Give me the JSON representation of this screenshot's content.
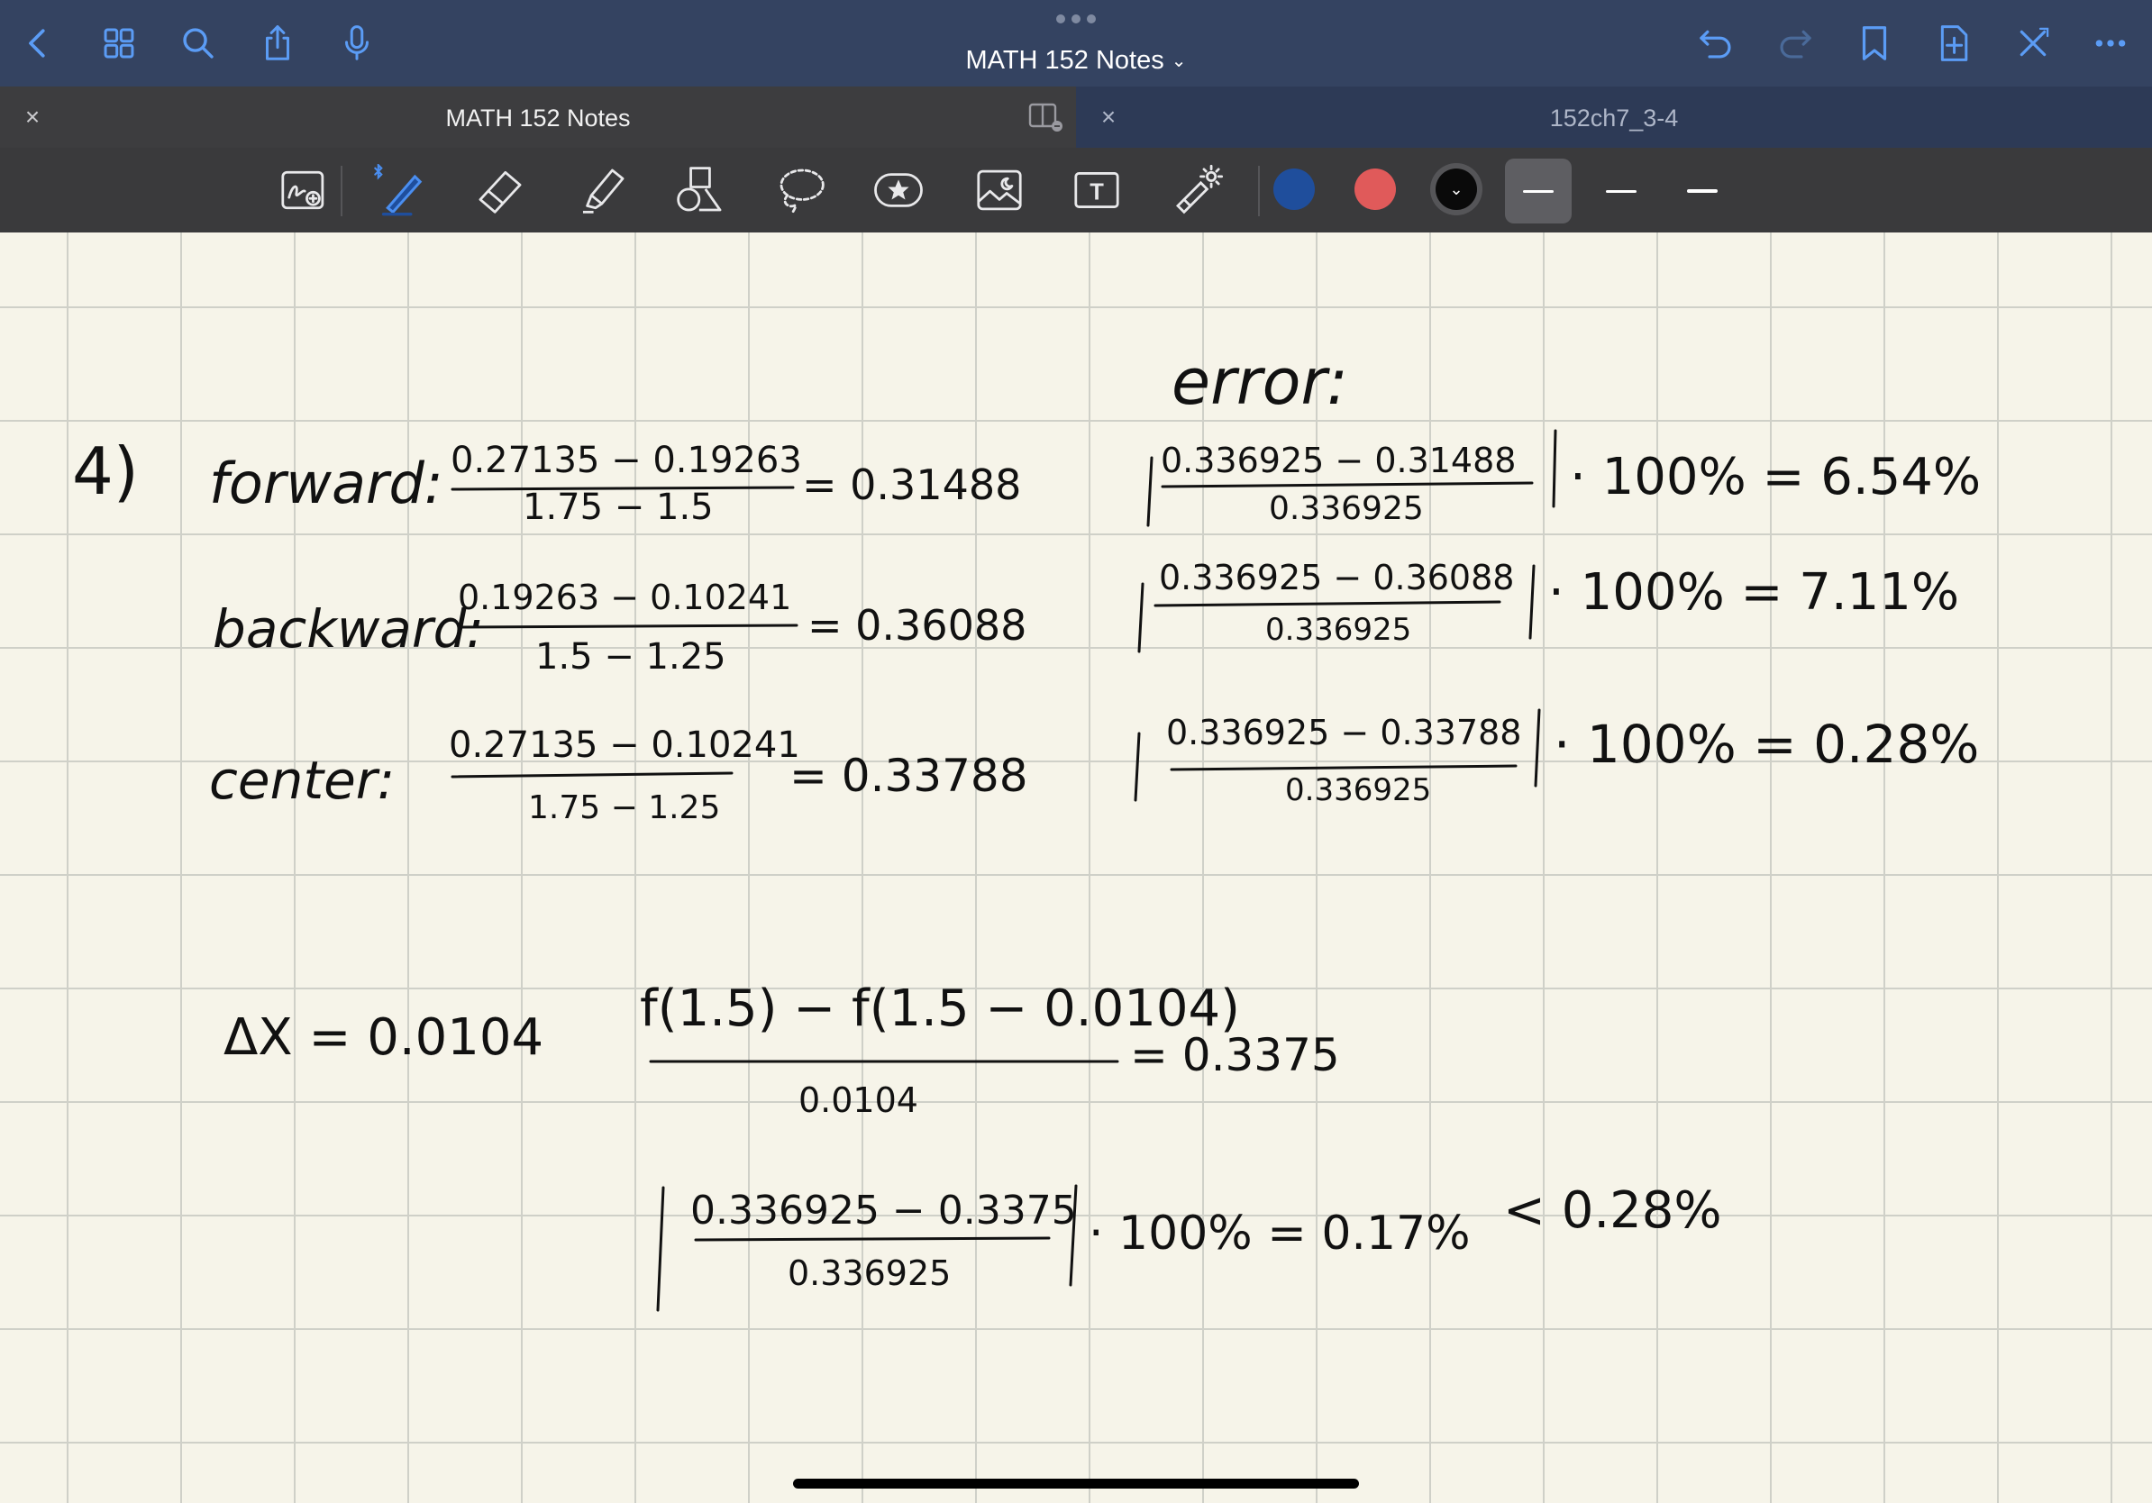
{
  "nav": {
    "title": "MATH 152 Notes",
    "left_icons": [
      "back-icon",
      "grid-icon",
      "search-icon",
      "share-icon",
      "microphone-icon"
    ],
    "right_icons": [
      "undo-icon",
      "redo-icon",
      "bookmark-icon",
      "add-page-icon",
      "close-x-icon",
      "more-icon"
    ]
  },
  "tabs": [
    {
      "label": "MATH 152 Notes",
      "active": true
    },
    {
      "label": "152ch7_3-4",
      "active": false
    }
  ],
  "toolbar": {
    "tools": [
      "zoom-window",
      "pen",
      "eraser",
      "highlighter",
      "shapes",
      "lasso",
      "sticker",
      "image",
      "text",
      "laser-pointer"
    ],
    "colors": [
      {
        "name": "blue",
        "hex": "#1f4e9c"
      },
      {
        "name": "red",
        "hex": "#e05a5a"
      },
      {
        "name": "black",
        "hex": "#0a0a0a",
        "selected": true
      }
    ],
    "stroke_widths": [
      "thin",
      "medium",
      "thick"
    ],
    "selected_stroke": "thin"
  },
  "notes": {
    "heading_error": "error:",
    "problem_number": "4)",
    "forward": {
      "label": "forward:",
      "numerator": "0.27135 − 0.19263",
      "denominator": "1.75 − 1.5",
      "result": "= 0.31488",
      "err_numerator": "0.336925 − 0.31488",
      "err_denominator": "0.336925",
      "err_result": "· 100% = 6.54%"
    },
    "backward": {
      "label": "backward:",
      "numerator": "0.19263 − 0.10241",
      "denominator": "1.5 − 1.25",
      "result": "= 0.36088",
      "err_numerator": "0.336925 − 0.36088",
      "err_denominator": "0.336925",
      "err_result": "· 100% = 7.11%"
    },
    "center": {
      "label": "center:",
      "numerator": "0.27135 − 0.10241",
      "denominator": "1.75 − 1.25",
      "result": "= 0.33788",
      "err_numerator": "0.336925 − 0.33788",
      "err_denominator": "0.336925",
      "err_result": "· 100% = 0.28%"
    },
    "delta_x": "ΔX = 0.0104",
    "diff_numerator": "f(1.5) − f(1.5 − 0.0104)",
    "diff_denominator": "0.0104",
    "diff_result": "= 0.3375",
    "final_numerator": "0.336925 − 0.3375",
    "final_denominator": "0.336925",
    "final_result": "· 100% = 0.17%",
    "comparison": "< 0.28%"
  }
}
